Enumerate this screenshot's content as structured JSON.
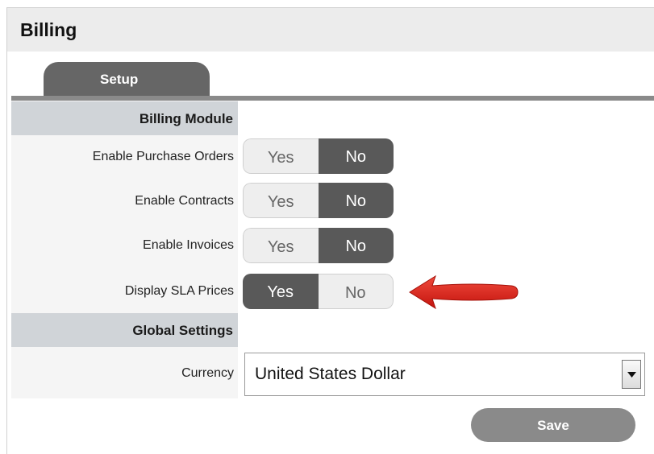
{
  "page": {
    "title": "Billing"
  },
  "tabs": [
    {
      "label": "Setup",
      "active": true
    }
  ],
  "sections": {
    "billing_module": {
      "title": "Billing Module"
    },
    "global_settings": {
      "title": "Global Settings"
    }
  },
  "settings": [
    {
      "label": "Enable Purchase Orders",
      "yes": "Yes",
      "no": "No",
      "selected": "No"
    },
    {
      "label": "Enable Contracts",
      "yes": "Yes",
      "no": "No",
      "selected": "No"
    },
    {
      "label": "Enable Invoices",
      "yes": "Yes",
      "no": "No",
      "selected": "No"
    },
    {
      "label": "Display SLA Prices",
      "yes": "Yes",
      "no": "No",
      "selected": "Yes"
    }
  ],
  "currency": {
    "label": "Currency",
    "value": "United States Dollar"
  },
  "actions": {
    "save_label": "Save"
  },
  "colors": {
    "annotation_arrow": "#e0231c",
    "toggle_selected": "#595959",
    "section_bar": "#d0d4d8"
  }
}
